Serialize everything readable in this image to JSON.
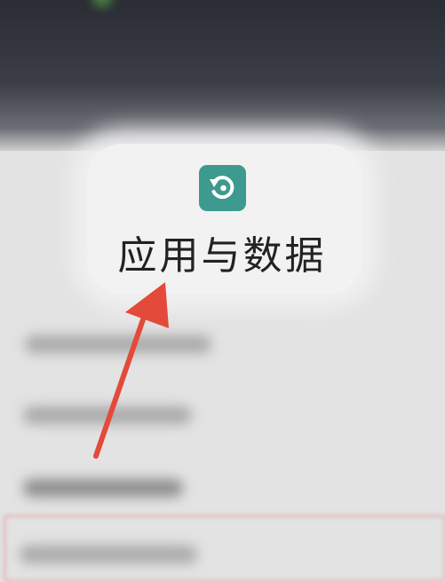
{
  "dialog": {
    "title": "应用与数据",
    "icon": "restore-icon",
    "icon_color": "#3e9a8e"
  },
  "annotation": {
    "arrow_color": "#e34a3a",
    "highlight_color": "#e89696"
  }
}
